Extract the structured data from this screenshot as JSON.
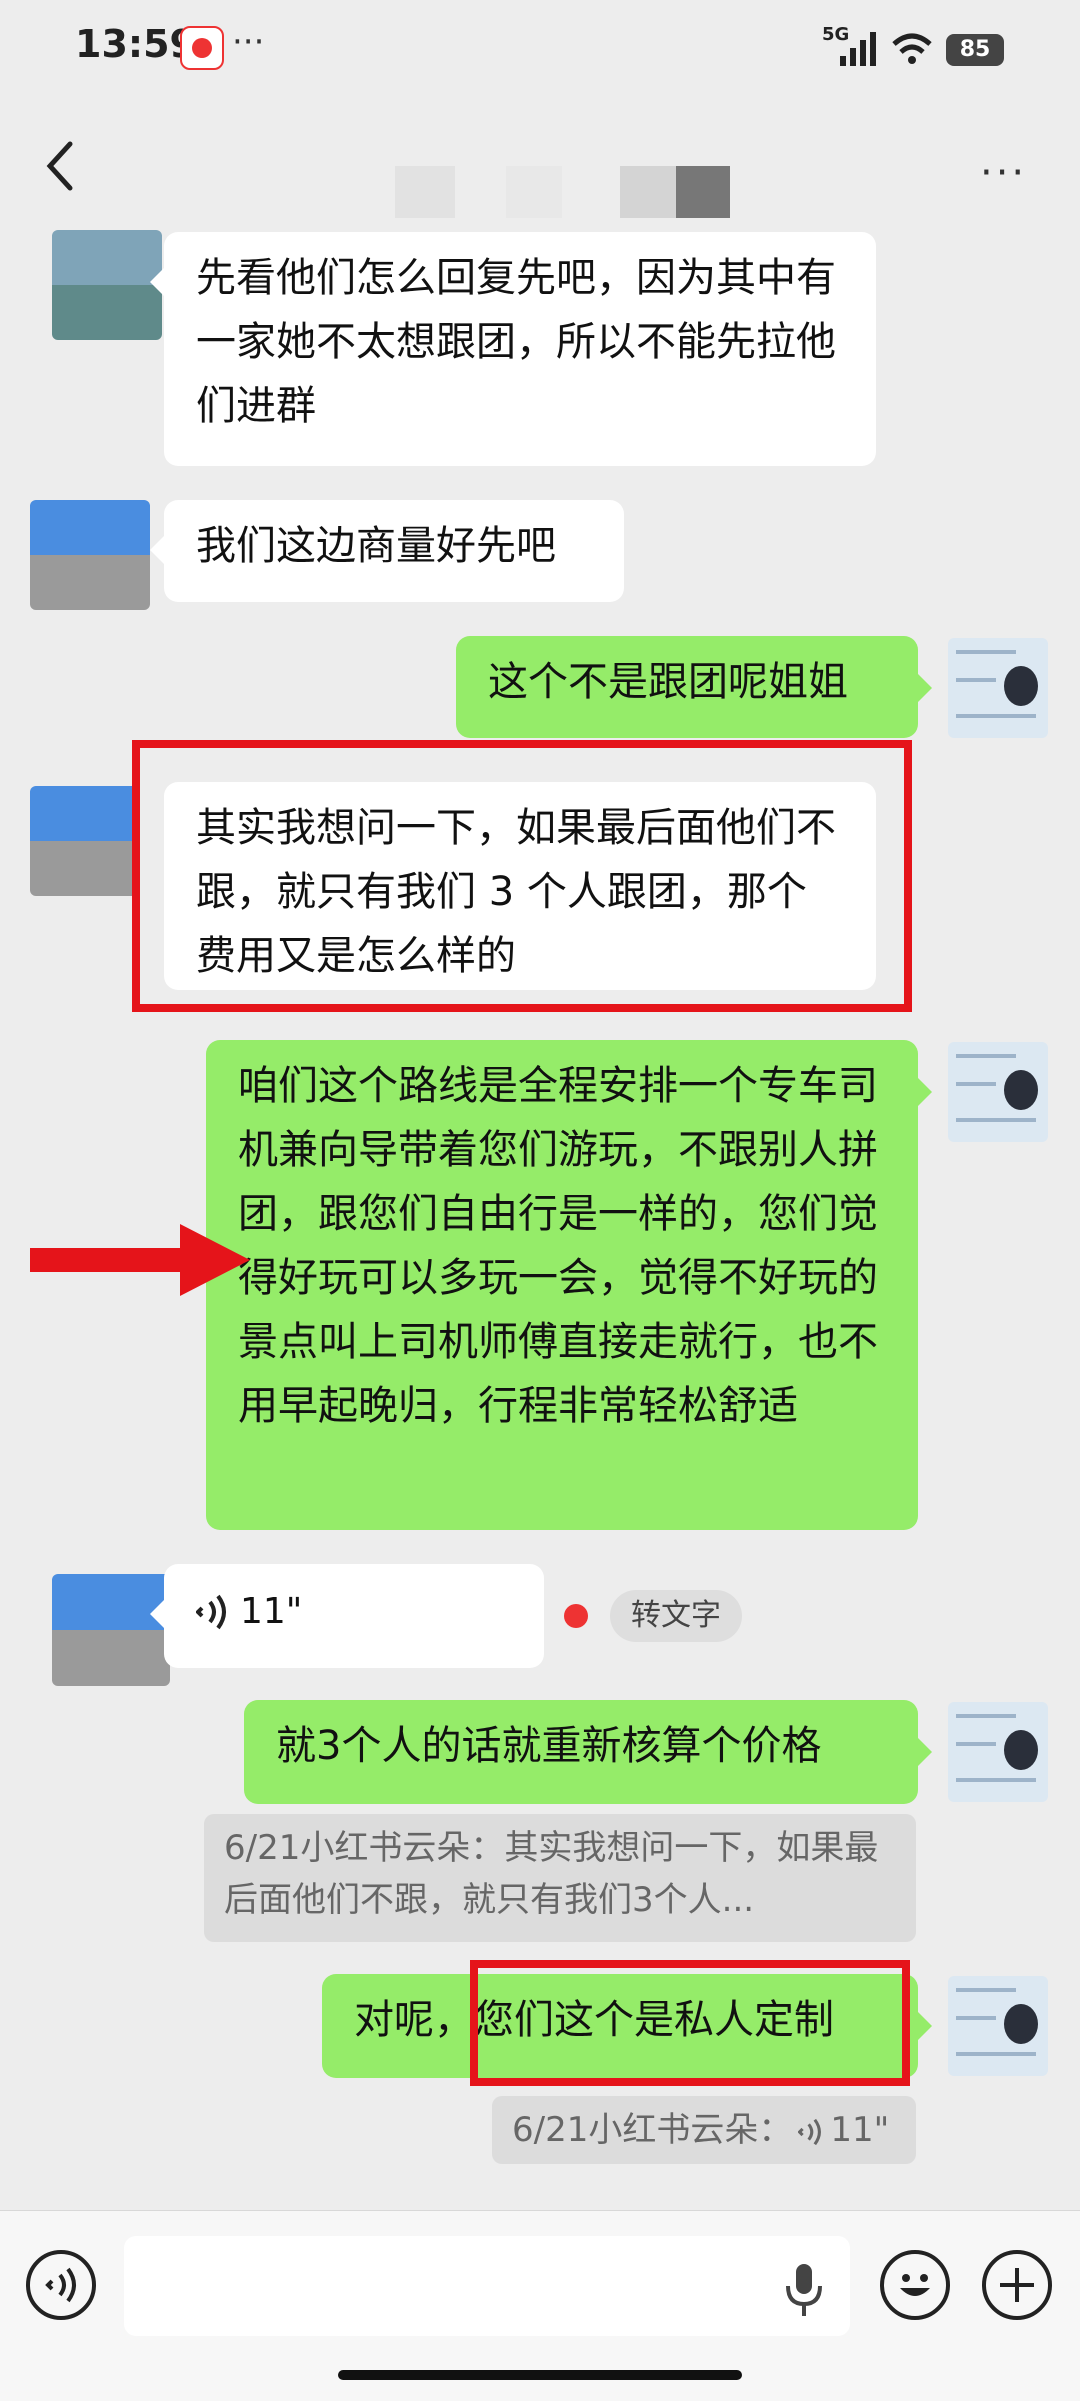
{
  "status_bar": {
    "time": "13:59",
    "dots": "···",
    "network": "5G",
    "battery": "85"
  },
  "header": {
    "back_icon": "chevron-left-icon",
    "more_label": "···"
  },
  "messages": [
    {
      "side": "in",
      "text": "先看他们怎么回复先吧，因为其中有一家她不太想跟团，所以不能先拉他们进群"
    },
    {
      "side": "in",
      "text": "我们这边商量好先吧"
    },
    {
      "side": "out",
      "text": "这个不是跟团呢姐姐"
    },
    {
      "side": "in",
      "text": "其实我想问一下，如果最后面他们不跟，就只有我们 3 个人跟团，那个费用又是怎么样的"
    },
    {
      "side": "out",
      "text": "咱们这个路线是全程安排一个专车司机兼向导带着您们游玩，不跟别人拼团，跟您们自由行是一样的，您们觉得好玩可以多玩一会，觉得不好玩的景点叫上司机师傅直接走就行，也不用早起晚归，行程非常轻松舒适"
    },
    {
      "side": "in",
      "type": "voice",
      "duration": "11\"",
      "convert_label": "转文字"
    },
    {
      "side": "out",
      "text": "就3个人的话就重新核算个价格",
      "quote": "6/21小红书云朵：其实我想问一下，如果最后面他们不跟，就只有我们3个人..."
    },
    {
      "side": "out",
      "text_a": "对呢，",
      "text_b": "您们这个是私人定制",
      "quote_prefix": "6/21小红书云朵：",
      "quote_voice": "11\""
    }
  ],
  "colors": {
    "outgoing": "#95ec69",
    "incoming": "#ffffff",
    "highlight": "#e5141a",
    "background": "#ededed"
  },
  "input_bar": {
    "voice_icon": "voice-mode-icon",
    "mic_icon": "microphone-icon",
    "emoji_icon": "emoji-icon",
    "plus_icon": "plus-icon"
  }
}
